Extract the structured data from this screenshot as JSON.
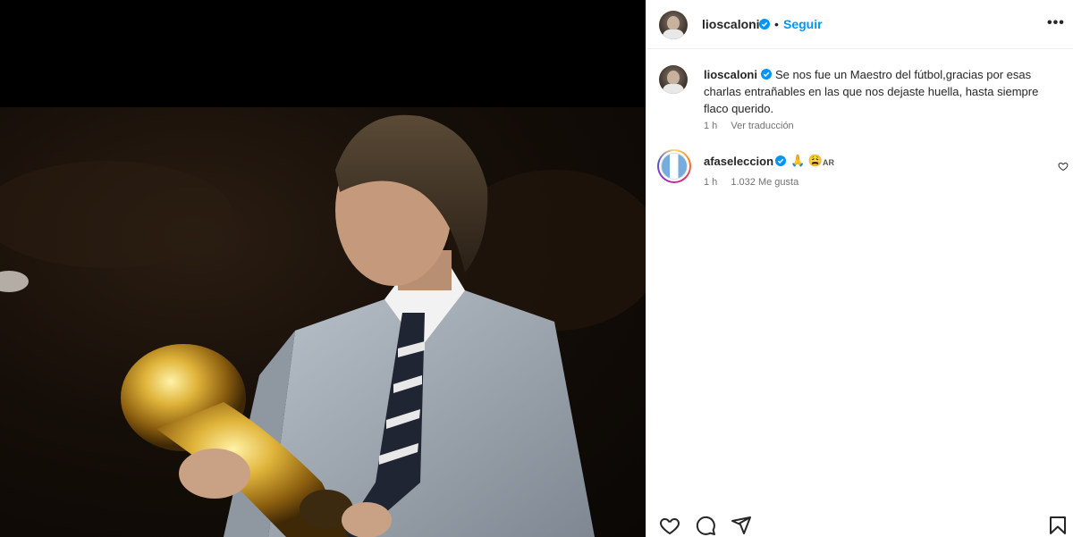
{
  "post": {
    "author": "lioscaloni",
    "follow_label": "Seguir",
    "separator": "•",
    "more_label": "•••"
  },
  "caption": {
    "author": "lioscaloni",
    "text": "Se nos fue un Maestro del fútbol,gracias por esas charlas entrañables en las que nos dejaste huella, hasta siempre flaco querido.",
    "time": "1 h",
    "translate_label": "Ver traducción"
  },
  "comment": {
    "author": "afaseleccion",
    "emojis": "🙏 😩",
    "flag_label": "AR",
    "time": "1 h",
    "likes": "1.032 Me gusta"
  },
  "icons": {
    "like": "heart-icon",
    "comment": "comment-icon",
    "share": "share-icon",
    "save": "bookmark-icon",
    "verified": "verified-badge-icon"
  },
  "colors": {
    "accent": "#0095f6",
    "verified": "#0095f6",
    "meta": "#737373"
  }
}
